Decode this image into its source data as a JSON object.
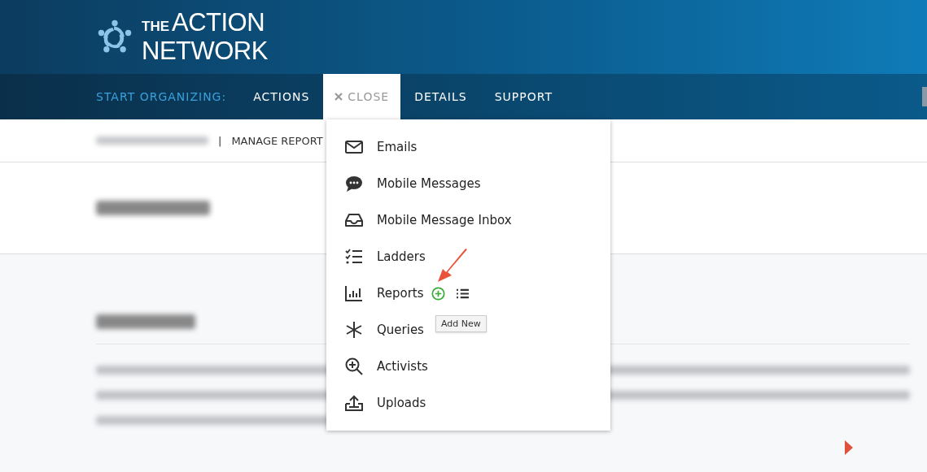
{
  "logo": {
    "small": "THE",
    "line1": "ACTION",
    "line2": "NETWORK"
  },
  "nav": {
    "label": "START ORGANIZING:",
    "items": [
      {
        "label": "ACTIONS",
        "selected": false
      },
      {
        "label": "CLOSE",
        "selected": true
      },
      {
        "label": "DETAILS",
        "selected": false
      },
      {
        "label": "SUPPORT",
        "selected": false
      }
    ]
  },
  "breadcrumb": {
    "separator": "|",
    "current": "MANAGE REPORT"
  },
  "menu": [
    {
      "label": "Emails"
    },
    {
      "label": "Mobile Messages"
    },
    {
      "label": "Mobile Message Inbox"
    },
    {
      "label": "Ladders"
    },
    {
      "label": "Reports",
      "actions": true
    },
    {
      "label": "Queries"
    },
    {
      "label": "Activists"
    },
    {
      "label": "Uploads"
    }
  ],
  "tooltip": "Add New"
}
